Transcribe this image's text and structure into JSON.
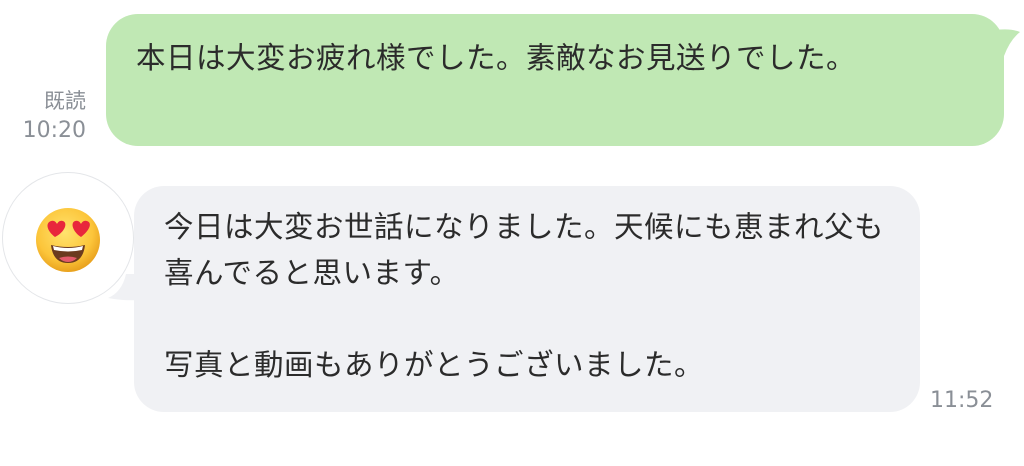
{
  "outgoing": {
    "text": "本日は大変お疲れ様でした。素敵なお見送りでした。",
    "read_label": "既読",
    "time": "10:20",
    "bubble_color": "#c0e8b4"
  },
  "incoming": {
    "text": "今日は大変お世話になりました。天候にも恵まれ父も喜んでると思います。\n\n写真と動画もありがとうございました。",
    "time": "11:52",
    "avatar_icon": "heart-eyes-emoji-icon",
    "bubble_color": "#f0f1f4"
  }
}
